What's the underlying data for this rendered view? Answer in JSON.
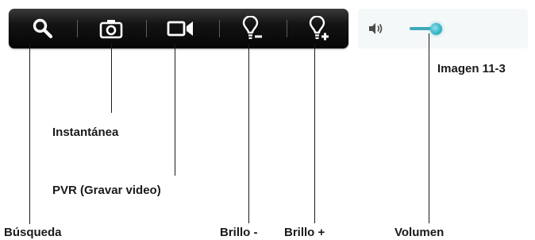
{
  "toolbar": {
    "buttons": [
      {
        "icon": "search-icon"
      },
      {
        "icon": "camera-icon"
      },
      {
        "icon": "video-camera-icon"
      },
      {
        "icon": "bulb-minus-icon"
      },
      {
        "icon": "bulb-plus-icon"
      }
    ],
    "colors": {
      "background": "#0a0a0a",
      "icon": "#ffffff"
    }
  },
  "volume": {
    "icon": "speaker-icon",
    "accent": "#3bb7c6"
  },
  "figure_caption": "Imagen 11-3",
  "labels": {
    "busqueda": "Búsqueda",
    "instantanea": "Instantánea",
    "pvr": "PVR (Gravar video)",
    "brillo_menos": "Brillo -",
    "brillo_mas": "Brillo +",
    "volumen": "Volumen"
  }
}
